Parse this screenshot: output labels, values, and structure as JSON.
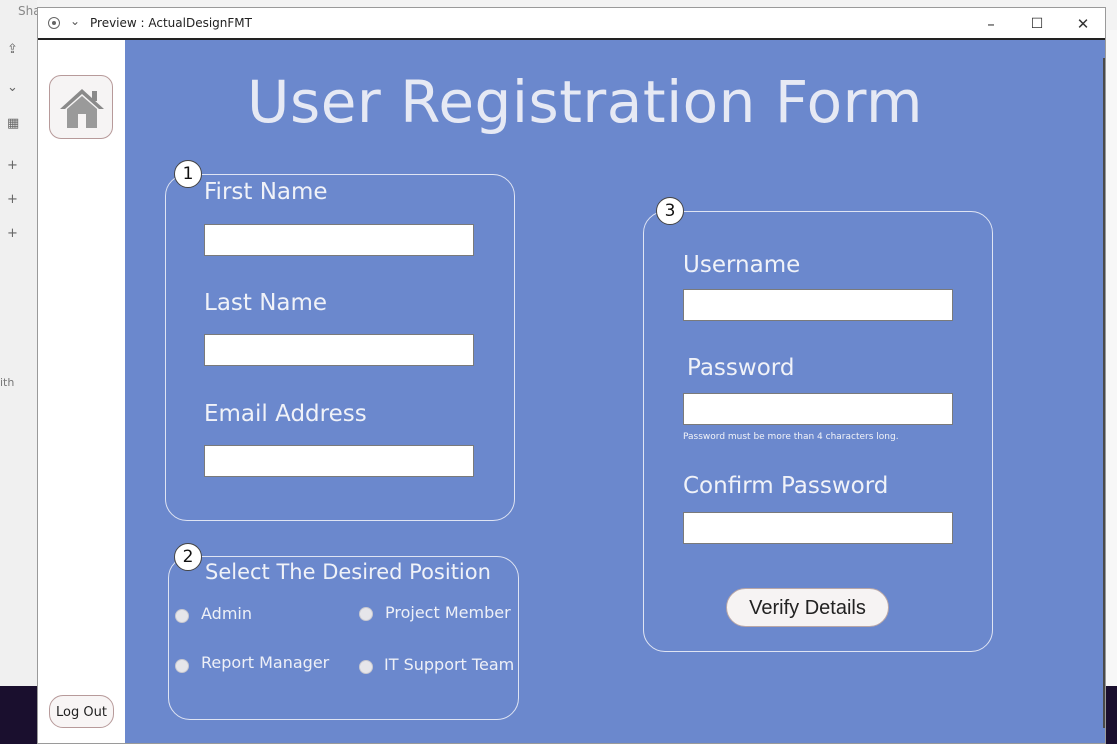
{
  "window": {
    "title": "Preview : ActualDesignFMT",
    "minimize": "–",
    "maximize": "☐",
    "close": "✕"
  },
  "background": {
    "app_fragment": "Sha",
    "sidebar_fragment": "ith"
  },
  "sidebar": {
    "home_icon": "home-icon",
    "logout_label": "Log Out"
  },
  "page": {
    "title": "User Registration Form"
  },
  "section1": {
    "badge": "1",
    "first_name_label": "First Name",
    "first_name_value": "",
    "last_name_label": "Last Name",
    "last_name_value": "",
    "email_label": "Email Address",
    "email_value": ""
  },
  "section2": {
    "badge": "2",
    "heading": "Select The Desired Position",
    "options": [
      "Admin",
      "Project Member",
      "Report Manager",
      "IT Support Team"
    ]
  },
  "section3": {
    "badge": "3",
    "username_label": "Username",
    "username_value": "",
    "password_label": "Password",
    "password_value": "",
    "password_hint": "Password must be more than 4 characters long.",
    "confirm_label": "Confirm Password",
    "confirm_value": "",
    "verify_label": "Verify Details"
  },
  "colors": {
    "form_background": "#6b88cd",
    "panel_border": "#dfe4f3",
    "title_text": "#e6e9f4"
  }
}
